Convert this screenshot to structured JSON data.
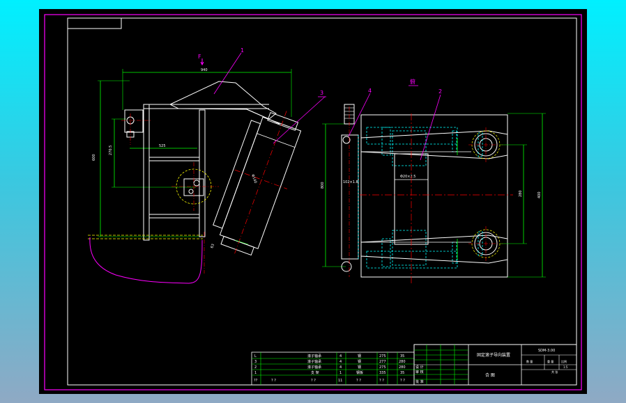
{
  "drawing": {
    "view_labels": {
      "force_label": "F",
      "plan_view_label": "俯"
    },
    "balloons": [
      "1",
      "3",
      "4",
      "2"
    ],
    "dimensions": {
      "overall_width": "940",
      "hinge_offset": "525",
      "vertical_total": "600",
      "vertical_partial": "270.5",
      "roller_dia": "Φ140",
      "roller_len": "102×1.8",
      "center_dist": "Φ20×2.5",
      "plan_height": "800",
      "plan_inner": "280",
      "plan_pitch": "400",
      "small_height": "63"
    },
    "parts_list": {
      "rows": [
        {
          "no": "L",
          "name": "滚子轴承",
          "qty": "4",
          "material": "钢",
          "weight": "275",
          "note": "35"
        },
        {
          "no": "3",
          "name": "滚子轴承",
          "qty": "4",
          "material": "钢",
          "weight": "277",
          "note": "280"
        },
        {
          "no": "2",
          "name": "滚子轴承",
          "qty": "4",
          "material": "钢",
          "weight": "275",
          "note": "280"
        },
        {
          "no": "1",
          "name": "支 架",
          "qty": "1",
          "material": "钢板",
          "weight": "335",
          "note": "35"
        },
        {
          "no": "??",
          "name": "? ?",
          "name2": "? ?",
          "qty": "11",
          "material": "? ?",
          "weight": "? ?",
          "note": "? ?"
        }
      ]
    },
    "title_block": {
      "title": "固定滚子导向装置",
      "drawing_no": "SDM-3.00",
      "scale_label": "比例",
      "scale_value": "1:5",
      "sheet_label": "共 张",
      "designer": "设 计",
      "checker": "审 核",
      "approver": "批 准",
      "assembly": "合 图",
      "material_box": "数 量",
      "weight_box": "重 量"
    }
  }
}
